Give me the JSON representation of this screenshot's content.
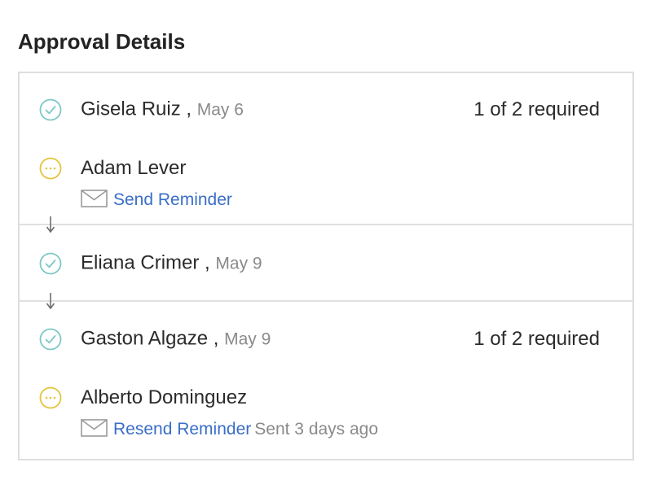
{
  "title": "Approval Details",
  "colors": {
    "approved": "#7cc8c6",
    "pending": "#e3c43a",
    "link": "#3a6ec8",
    "muted": "#8a8a8a",
    "border": "#dedede"
  },
  "steps": [
    {
      "required": "1 of 2 required",
      "approvers": [
        {
          "name": "Gisela Ruiz",
          "separator": ",",
          "date": "May 6",
          "status": "approved",
          "icon": "check-circle-icon"
        },
        {
          "name": "Adam Lever",
          "status": "pending",
          "icon": "ellipsis-circle-icon",
          "reminder": {
            "icon": "mail-icon",
            "link": "Send Reminder",
            "note": ""
          }
        }
      ]
    },
    {
      "required": "",
      "approvers": [
        {
          "name": "Eliana Crimer",
          "separator": ",",
          "date": "May 9",
          "status": "approved",
          "icon": "check-circle-icon"
        }
      ]
    },
    {
      "required": "1 of 2 required",
      "approvers": [
        {
          "name": "Gaston Algaze",
          "separator": ",",
          "date": "May 9",
          "status": "approved",
          "icon": "check-circle-icon"
        },
        {
          "name": "Alberto Dominguez",
          "status": "pending",
          "icon": "ellipsis-circle-icon",
          "reminder": {
            "icon": "mail-icon",
            "link": "Resend Reminder",
            "note": "Sent 3 days ago"
          }
        }
      ]
    }
  ]
}
